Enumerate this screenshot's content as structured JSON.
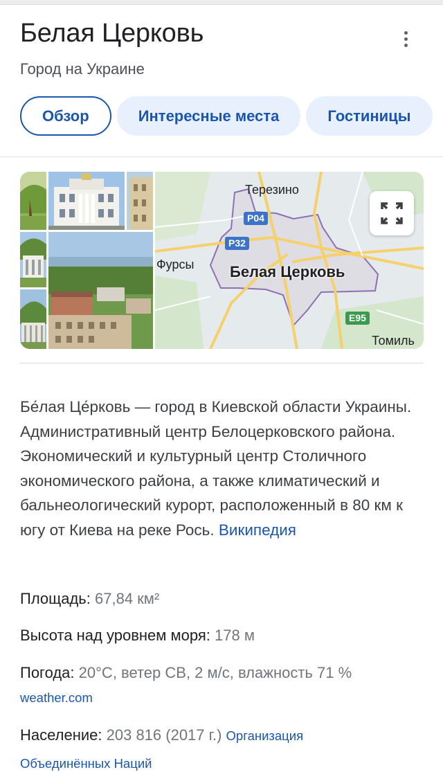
{
  "header": {
    "title": "Белая Церковь",
    "subtitle": "Город на Украине",
    "more_icon": "more-vert-icon"
  },
  "tabs": [
    {
      "label": "Обзор",
      "active": true
    },
    {
      "label": "Интересные места",
      "active": false
    },
    {
      "label": "Гостиницы",
      "active": false
    }
  ],
  "map": {
    "city_label": "Белая Церковь",
    "places": [
      "Терезино",
      "Фурсы",
      "Томиль"
    ],
    "roads": [
      "P04",
      "P32",
      "E95"
    ],
    "expand_icon": "fullscreen-icon"
  },
  "description": {
    "text": "Бе́лая Це́рковь — город в Киевской области Украины. Административный центр Белоцерковского района. Экономический и культурный центр Столичного экономического района, а также климатический и бальнеологический курорт, расположенный в 80 км к югу от Киева на реке Рось.",
    "source_link": "Википедия"
  },
  "facts": {
    "area": {
      "label": "Площадь:",
      "value": "67,84 км²"
    },
    "elevation": {
      "label": "Высота над уровнем моря:",
      "value": "178 м"
    },
    "weather": {
      "label": "Погода:",
      "value": "20°C, ветер СВ, 2 м/с, влажность 71 %",
      "source": "weather.com"
    },
    "population": {
      "label": "Население:",
      "value": "203 816 (2017 г.)",
      "source_part1": "Организация",
      "source_part2": "Объединённых Наций"
    }
  },
  "colors": {
    "link": "#1a56b0",
    "chip_bg": "#e8f0fe",
    "map_boundary": "#8e6fb5",
    "road_yellow": "#f5d06b",
    "road_badge_blue": "#3b73c8",
    "road_badge_green": "#3a9a4e"
  }
}
